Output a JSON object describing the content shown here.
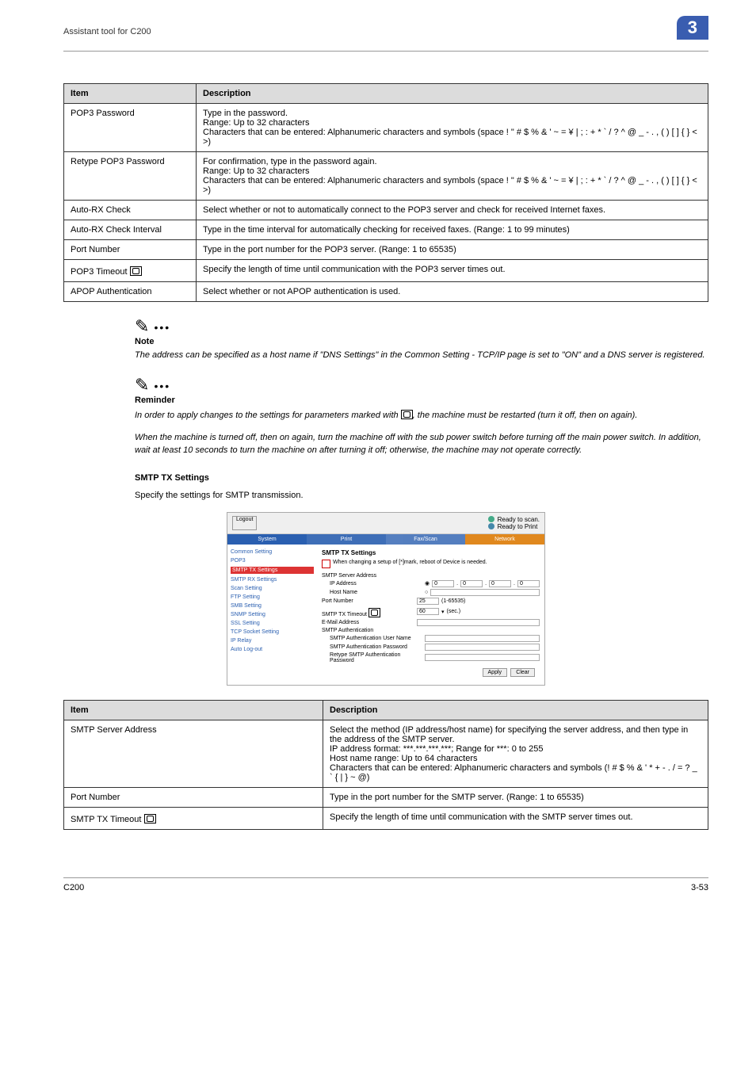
{
  "header": {
    "title": "Assistant tool for C200",
    "badge": "3"
  },
  "table1": {
    "head": {
      "item": "Item",
      "desc": "Description"
    },
    "rows": [
      {
        "item": "POP3 Password",
        "desc": "Type in the password.\nRange: Up to 32 characters\nCharacters that can be entered: Alphanumeric characters and symbols (space ! \" # $ % & ' ~ = ¥ | ; : + * ` / ? ^ @ _ - . , ( ) [ ] { } < >)"
      },
      {
        "item": "Retype POP3 Password",
        "desc": "For confirmation, type in the password again.\nRange: Up to 32 characters\nCharacters that can be entered: Alphanumeric characters and symbols (space ! \" # $ % & ' ~ = ¥ | ; : + * ` / ? ^ @ _ - . , ( ) [ ] { } < >)"
      },
      {
        "item": "Auto-RX Check",
        "desc": "Select whether or not to automatically connect to the POP3 server and check for received Internet faxes."
      },
      {
        "item": "Auto-RX Check Interval",
        "desc": "Type in the time interval for automatically checking for received faxes. (Range: 1 to 99 minutes)"
      },
      {
        "item": "Port Number",
        "desc": "Type in the port number for the POP3 server. (Range: 1 to 65535)"
      },
      {
        "item": "POP3 Timeout",
        "icon": true,
        "desc": "Specify the length of time until communication with the POP3 server times out."
      },
      {
        "item": "APOP Authentication",
        "desc": "Select whether or not APOP authentication is used."
      }
    ]
  },
  "note": {
    "heading": "Note",
    "body": "The address can be specified as a host name if \"DNS Settings\" in the Common Setting - TCP/IP page is set to \"ON\" and a DNS server is registered."
  },
  "reminder": {
    "heading": "Reminder",
    "body1a": "In order to apply changes to the settings for parameters marked with ",
    "body1b": ", the machine must be restarted (turn it off, then on again).",
    "body2": "When the machine is turned off, then on again, turn the machine off with the sub power switch before turning off the main power switch. In addition, wait at least 10 seconds to turn the machine on after turning it off; otherwise, the machine may not operate correctly."
  },
  "section": {
    "heading": "SMTP TX Settings",
    "para": "Specify the settings for SMTP transmission."
  },
  "screenshot": {
    "ready_scan": "Ready to scan.",
    "ready_print": "Ready to Print",
    "logout": "Logout",
    "tabs": {
      "system": "System",
      "print": "Print",
      "fax": "Fax/Scan",
      "network": "Network"
    },
    "nav": {
      "common": "Common Setting",
      "pop3": "POP3",
      "smtptx": "SMTP TX Settings",
      "smtprx": "SMTP RX Settings",
      "scan": "Scan Setting",
      "ftp": "FTP Setting",
      "smb": "SMB Setting",
      "snmp": "SNMP Setting",
      "ssl": "SSL Setting",
      "tcp": "TCP Socket Setting",
      "relay": "IP Relay",
      "auto": "Auto Log-out"
    },
    "main": {
      "title": "SMTP TX Settings",
      "warn": "When changing a setup of [*]mark, reboot of Device is needed.",
      "rows": {
        "server": "SMTP Server Address",
        "ip": "IP Address",
        "ip_val": "0",
        "host": "Host Name",
        "port": "Port Number",
        "port_val": "25",
        "port_range": "(1-65535)",
        "timeout": "SMTP TX Timeout",
        "timeout_val": "60",
        "timeout_unit": "(sec.)",
        "email": "E-Mail Address",
        "auth": "SMTP Authentication",
        "authu": "SMTP Authentication User Name",
        "authp": "SMTP Authentication Password",
        "authr": "Retype SMTP Authentication Password"
      },
      "apply": "Apply",
      "clear": "Clear"
    }
  },
  "table2": {
    "head": {
      "item": "Item",
      "desc": "Description"
    },
    "rows": [
      {
        "item": "SMTP Server Address",
        "desc": "Select the method (IP address/host name) for specifying the server address, and then type in the address of the SMTP server.\nIP address format: ***.***.***.***; Range for ***: 0 to 255\nHost name range: Up to 64 characters\nCharacters that can be entered: Alphanumeric characters and symbols (! # $ % & ' * + - . / = ? _ ` { | } ~ @)"
      },
      {
        "item": "Port Number",
        "desc": "Type in the port number for the SMTP server. (Range: 1 to 65535)"
      },
      {
        "item": "SMTP TX Timeout",
        "icon": true,
        "desc": "Specify the length of time until communication with the SMTP server times out."
      }
    ]
  },
  "footer": {
    "left": "C200",
    "right": "3-53"
  }
}
